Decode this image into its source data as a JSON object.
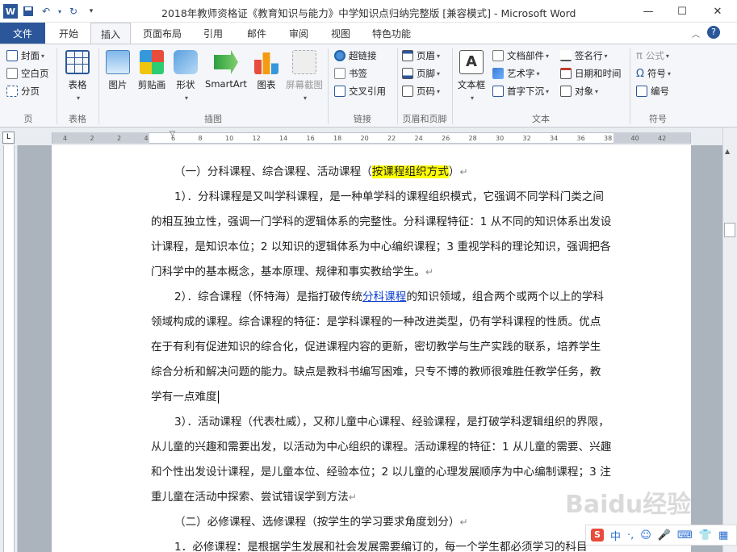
{
  "window": {
    "title": "2018年教师资格证《教育知识与能力》中学知识点归纳完整版 [兼容模式] - Microsoft Word",
    "minimize": "—",
    "maximize": "☐",
    "close": "✕"
  },
  "tabs": {
    "file": "文件",
    "home": "开始",
    "insert": "插入",
    "layout": "页面布局",
    "references": "引用",
    "mailings": "邮件",
    "review": "审阅",
    "view": "视图",
    "features": "特色功能"
  },
  "ribbon": {
    "pages": {
      "cover": "封面",
      "blank": "空白页",
      "break": "分页",
      "label": "页"
    },
    "tables": {
      "table": "表格",
      "label": "表格"
    },
    "illustrations": {
      "picture": "图片",
      "clipart": "剪贴画",
      "shapes": "形状",
      "smartart": "SmartArt",
      "chart": "图表",
      "screenshot": "屏幕截图",
      "label": "插图"
    },
    "links": {
      "hyperlink": "超链接",
      "bookmark": "书签",
      "crossref": "交叉引用",
      "label": "链接"
    },
    "headerfooter": {
      "header": "页眉",
      "footer": "页脚",
      "pagenum": "页码",
      "label": "页眉和页脚"
    },
    "text": {
      "textbox": "文本框",
      "quickparts": "文档部件",
      "wordart": "艺术字",
      "dropcap": "首字下沉",
      "signature": "签名行",
      "datetime": "日期和时间",
      "object": "对象",
      "label": "文本"
    },
    "symbols": {
      "equation": "公式",
      "symbol": "符号",
      "number": "编号",
      "label": "符号"
    }
  },
  "ruler": [
    "4",
    "2",
    "2",
    "4",
    "6",
    "8",
    "10",
    "12",
    "14",
    "16",
    "18",
    "20",
    "22",
    "24",
    "26",
    "28",
    "30",
    "32",
    "34",
    "36",
    "38",
    "40",
    "42"
  ],
  "document": {
    "lines": [
      {
        "text": "（一）分科课程、综合课程、活动课程（"
      },
      {
        "text": "按课程组织方式"
      },
      {
        "text": "）"
      },
      {
        "text": "1）．分科课程是又叫学科课程，是一种单学科的课程组织模式，它强调不同学科门类之间"
      },
      {
        "text": "的相互独立性，强调一门学科的逻辑体系的完整性。分科课程特征：1 从不同的知识体系出发设"
      },
      {
        "text": "计课程，是知识本位；2 以知识的逻辑体系为中心编织课程；3 重视学科的理论知识，强调把各"
      },
      {
        "text": "门科学中的基本概念，基本原理、规律和事实教给学生。"
      },
      {
        "text": "2）．综合课程（怀特海）是指打破传统"
      },
      {
        "text": "分科课程"
      },
      {
        "text": "的知识领域，组合两个或两个以上的学科"
      },
      {
        "text": "领域构成的课程。综合课程的特征：是学科课程的一种改进类型，仍有学科课程的性质。优点"
      },
      {
        "text": "在于有利有促进知识的综合化，促进课程内容的更新，密切教学与生产实践的联系，培养学生"
      },
      {
        "text": "综合分析和解决问题的能力。缺点是教科书编写困难，只专不博的教师很难胜任教学任务，教"
      },
      {
        "text": "学有一点难度"
      },
      {
        "text": "3）．活动课程（代表杜威），又称儿童中心课程、经验课程，是打破学科逻辑组织的界限，"
      },
      {
        "text": "从儿童的兴趣和需要出发，以活动为中心组织的课程。活动课程的特征：1 从儿童的需要、兴趣"
      },
      {
        "text": "和个性出发设计课程，是儿童本位、经验本位；2 以儿童的心理发展顺序为中心编制课程；3 注"
      },
      {
        "text": "重儿童在活动中探索、尝试错误学到方法"
      },
      {
        "text": "（二）必修课程、选修课程（按学生的学习要求角度划分）"
      },
      {
        "text": "1．必修课程：是根据学生发展和社会发展需要编订的，每一个学生都必须学习的科目"
      }
    ]
  },
  "ime": {
    "logo": "S",
    "mode": "中",
    "punct": "·,"
  },
  "watermark": "Baidu经验"
}
